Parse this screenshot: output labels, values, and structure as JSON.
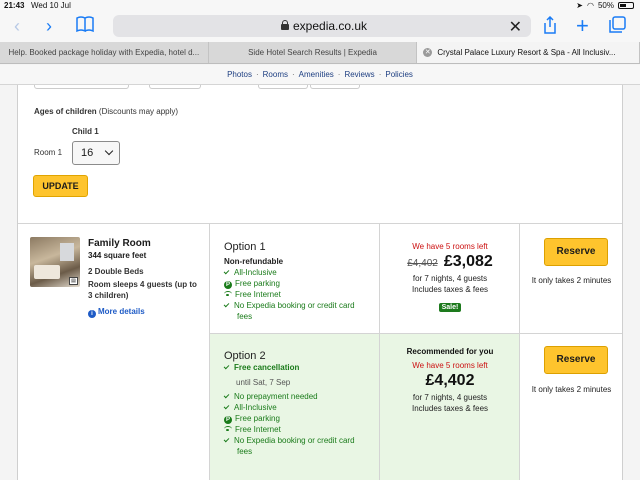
{
  "status_bar": {
    "time": "21:43",
    "date": "Wed 10 Jul",
    "battery": "50%",
    "battery_level": 0.5
  },
  "browser": {
    "url": "expedia.co.uk",
    "tabs": [
      {
        "label": "Help. Booked package holiday with Expedia, hotel d..."
      },
      {
        "label": "Side Hotel Search Results | Expedia"
      },
      {
        "label": "Crystal Palace Luxury Resort & Spa - All Inclusiv..."
      }
    ]
  },
  "hotel_nav": {
    "items": [
      "Photos",
      "Rooms",
      "Amenities",
      "Reviews",
      "Policies"
    ],
    "separator": "·"
  },
  "children_form": {
    "heading": "Ages of children",
    "note": "(Discounts may apply)",
    "child_label": "Child 1",
    "room_label": "Room 1",
    "age_value": "16",
    "update_label": "UPDATE"
  },
  "room": {
    "name": "Family Room",
    "size": "344 square feet",
    "beds": "2 Double Beds",
    "sleeps": "Room sleeps 4 guests (up to 3 children)",
    "more_details": "More details",
    "options": [
      {
        "title": "Option 1",
        "policy": "Non-refundable",
        "features": [
          "All-Inclusive",
          "Free parking",
          "Free Internet",
          "No Expedia booking or credit card",
          "fees"
        ],
        "rooms_left": "We have 5 rooms left",
        "old_price": "£4,402",
        "price": "£3,082",
        "stay": "for 7 nights, 4 guests",
        "taxes": "Includes taxes & fees",
        "badge": "Sale!",
        "reserve_label": "Reserve",
        "hurry": "It only takes 2 minutes"
      },
      {
        "title": "Option 2",
        "policy": "Free cancellation",
        "until": "until Sat, 7 Sep",
        "features": [
          "No prepayment needed",
          "All-Inclusive",
          "Free parking",
          "Free Internet",
          "No Expedia booking or credit card",
          "fees"
        ],
        "recommended": "Recommended for you",
        "rooms_left": "We have 5 rooms left",
        "price": "£4,402",
        "stay": "for 7 nights, 4 guests",
        "taxes": "Includes taxes & fees",
        "reserve_label": "Reserve",
        "hurry": "It only takes 2 minutes"
      }
    ]
  }
}
